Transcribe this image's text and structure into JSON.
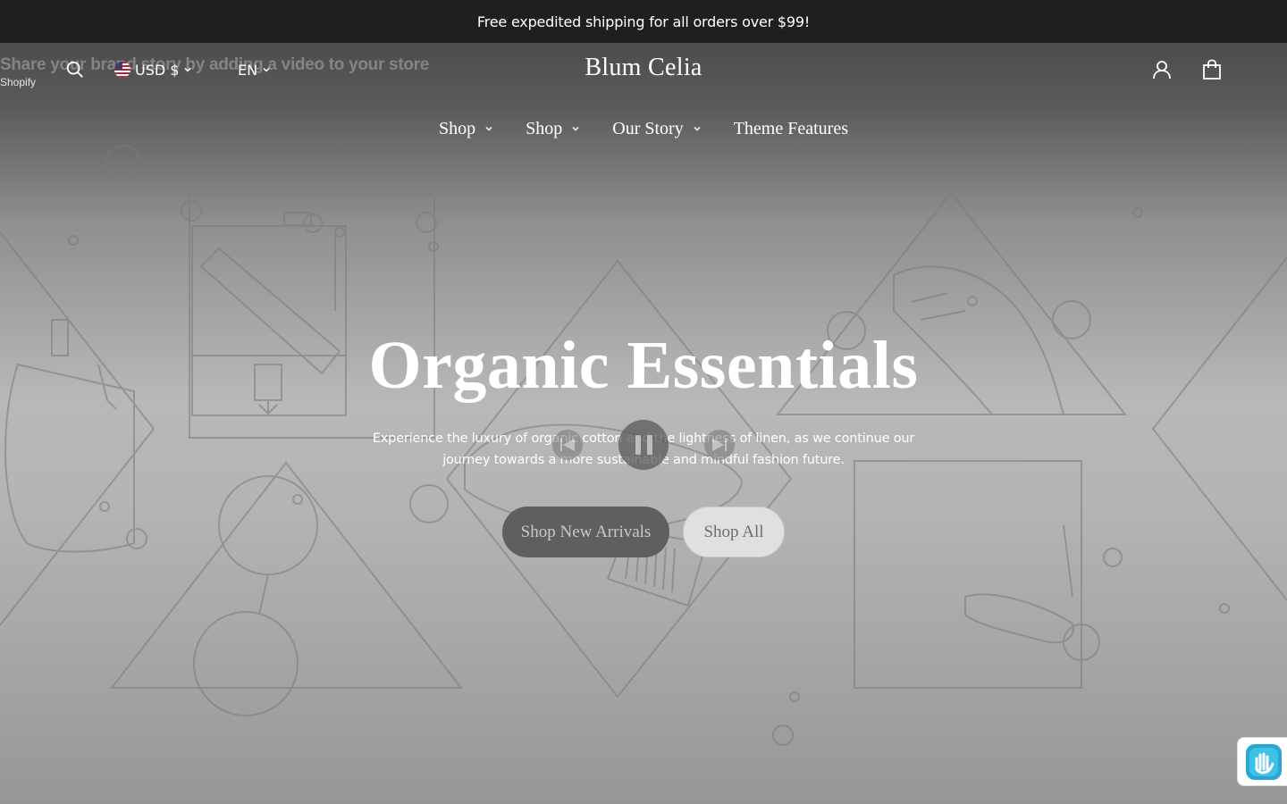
{
  "announcement": {
    "text": "Free expedited shipping for all orders over $99!"
  },
  "video": {
    "title": "Share your brand story by adding a video to your store",
    "source": "Shopify"
  },
  "header": {
    "currency": "USD $",
    "language": "EN",
    "logo": "Blum Celia",
    "icons": [
      "search-icon",
      "account-icon",
      "cart-icon"
    ]
  },
  "nav": {
    "items": [
      {
        "label": "Shop",
        "has_dropdown": true
      },
      {
        "label": "Shop",
        "has_dropdown": true
      },
      {
        "label": "Our Story",
        "has_dropdown": true
      },
      {
        "label": "Theme Features",
        "has_dropdown": false
      }
    ]
  },
  "hero": {
    "headline": "Organic Essentials",
    "subtext": "Experience the luxury of organic cotton and the lightness of linen, as we continue our journey towards a more sustainable and mindful fashion future.",
    "primary_button": "Shop New Arrivals",
    "secondary_button": "Shop All"
  },
  "colors": {
    "announcement_bg": "#1f1f1f",
    "header_text": "#ffffff",
    "primary_button_bg": "#5f5f5f",
    "secondary_button_bg": "#e0e0e0"
  }
}
